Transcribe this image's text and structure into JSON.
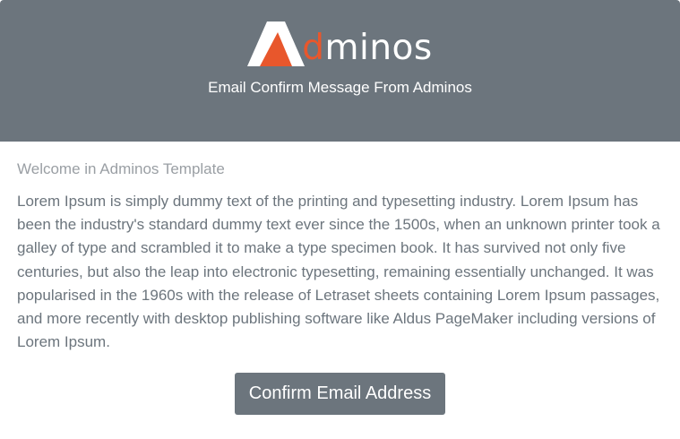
{
  "header": {
    "logo": {
      "accent_letter": "d",
      "rest_text": "minos",
      "accent_color": "#e8572c",
      "icon": "adminos-a-logo-icon"
    },
    "subtitle": "Email Confirm Message From Adminos",
    "background": "#6c757d"
  },
  "content": {
    "welcome": "Welcome in Adminos Template",
    "paragraph": "Lorem Ipsum is simply dummy text of the printing and typesetting industry. Lorem Ipsum has been the industry's standard dummy text ever since the 1500s, when an unknown printer took a galley of type and scrambled it to make a type specimen book. It has survived not only five centuries, but also the leap into electronic typesetting, remaining essentially unchanged. It was popularised in the 1960s with the release of Letraset sheets containing Lorem Ipsum passages, and more recently with desktop publishing software like Aldus PageMaker including versions of Lorem Ipsum."
  },
  "actions": {
    "confirm_label": "Confirm Email Address",
    "button_color": "#6c757d"
  }
}
